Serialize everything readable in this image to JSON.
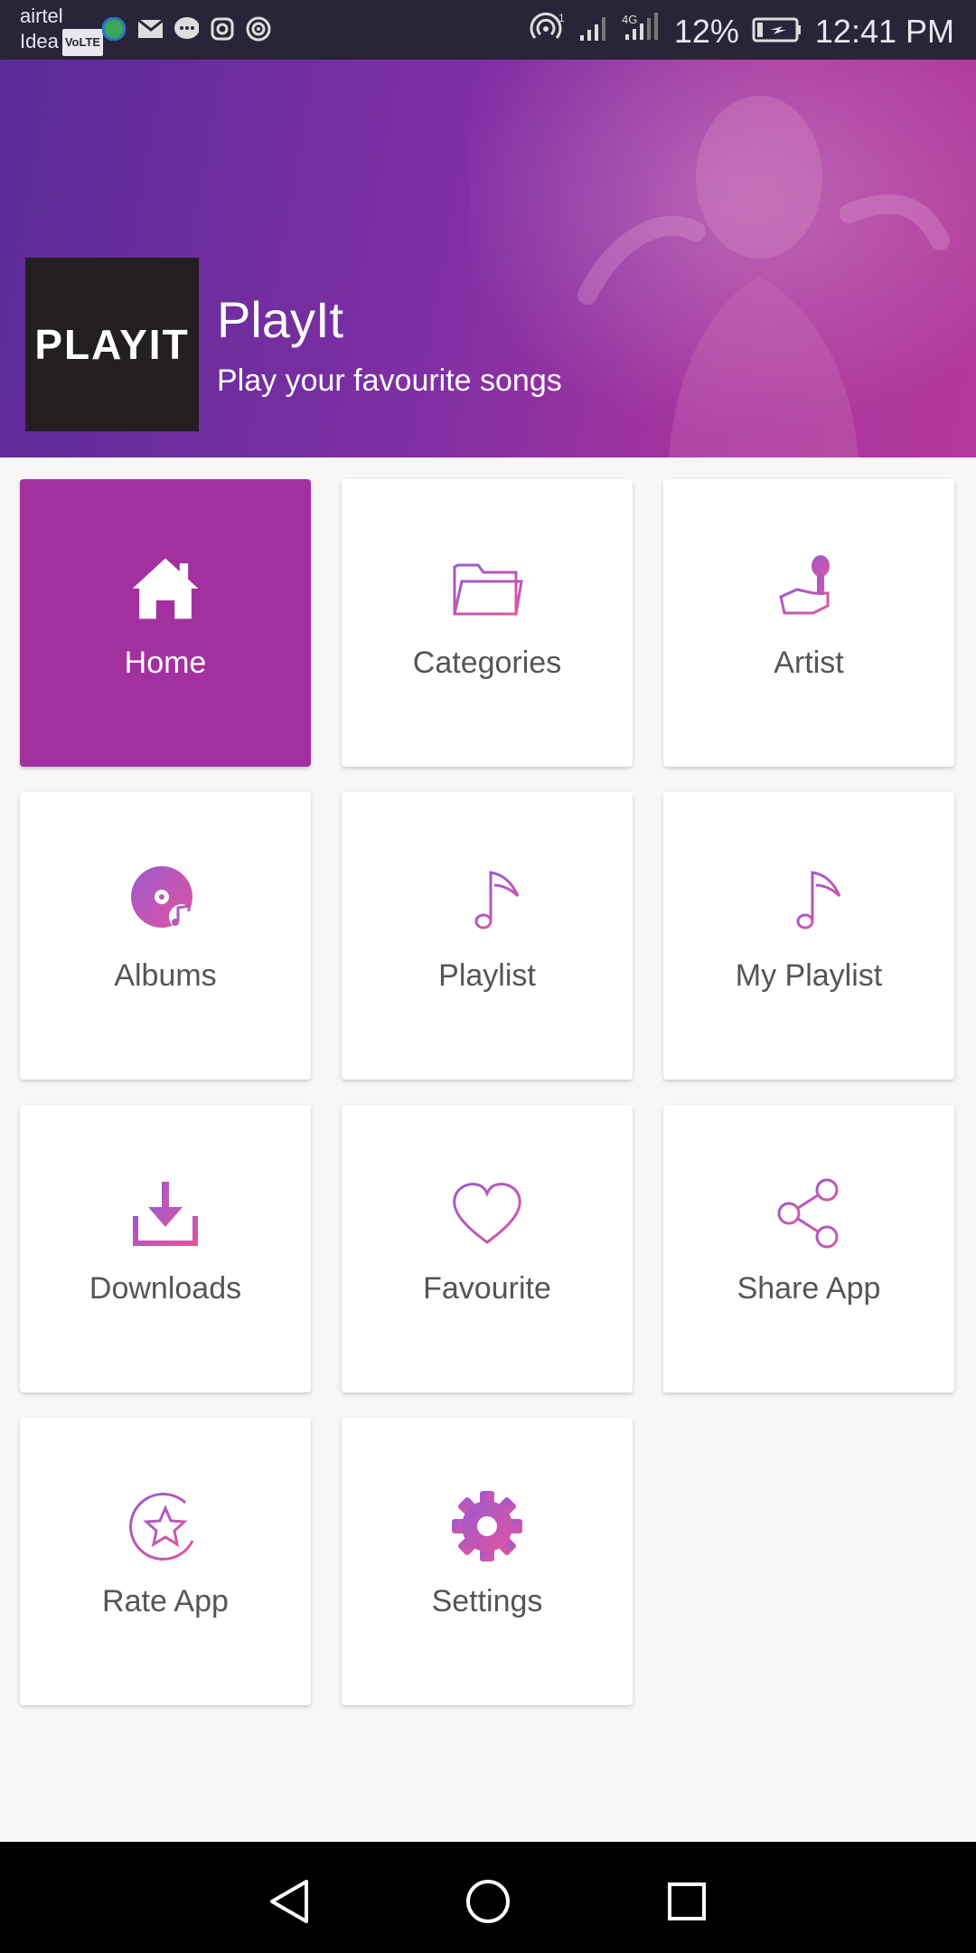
{
  "status_bar": {
    "carrier_1": "airtel",
    "carrier_2": "Idea",
    "volte": "VoLTE",
    "hotspot_count": "1",
    "network": "4G",
    "battery": "12%",
    "time": "12:41 PM"
  },
  "header": {
    "logo_text": "PLAYIT",
    "title": "PlayIt",
    "subtitle": "Play your favourite songs"
  },
  "menu": [
    {
      "label": "Home",
      "icon": "home-icon",
      "active": true
    },
    {
      "label": "Categories",
      "icon": "folder-icon",
      "active": false
    },
    {
      "label": "Artist",
      "icon": "microphone-icon",
      "active": false
    },
    {
      "label": "Albums",
      "icon": "album-icon",
      "active": false
    },
    {
      "label": "Playlist",
      "icon": "playlist-icon",
      "active": false
    },
    {
      "label": "My Playlist",
      "icon": "playlist-icon",
      "active": false
    },
    {
      "label": "Downloads",
      "icon": "download-icon",
      "active": false
    },
    {
      "label": "Favourite",
      "icon": "heart-icon",
      "active": false
    },
    {
      "label": "Share App",
      "icon": "share-icon",
      "active": false
    },
    {
      "label": "Rate App",
      "icon": "star-icon",
      "active": false
    },
    {
      "label": "Settings",
      "icon": "gear-icon",
      "active": false
    }
  ],
  "colors": {
    "accent": "#a2319f",
    "icon_gradient_start": "#9b59d0",
    "icon_gradient_end": "#e0559e"
  }
}
